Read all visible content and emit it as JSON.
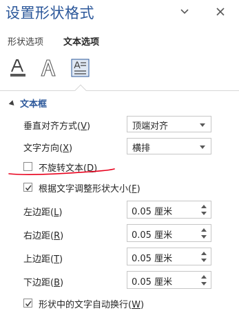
{
  "pane": {
    "title": "设置形状格式"
  },
  "tabs": {
    "shape_options": "形状选项",
    "text_options": "文本选项"
  },
  "section": {
    "title": "文本框"
  },
  "fields": {
    "vertical_align": {
      "label": "垂直对齐方式",
      "key": "V",
      "value": "顶端对齐"
    },
    "text_direction": {
      "label": "文字方向",
      "key": "X",
      "value": "横排"
    },
    "no_rotate": {
      "label": "不旋转文本",
      "key": "D",
      "checked": false
    },
    "autofit": {
      "label": "根据文字调整形状大小",
      "key": "F",
      "checked": true
    },
    "left_margin": {
      "label": "左边距",
      "key": "L",
      "value": "0.05 厘米"
    },
    "right_margin": {
      "label": "右边距",
      "key": "R",
      "value": "0.05 厘米"
    },
    "top_margin": {
      "label": "上边距",
      "key": "T",
      "value": "0.05 厘米"
    },
    "bottom_margin": {
      "label": "下边距",
      "key": "B",
      "value": "0.05 厘米"
    },
    "wrap_text": {
      "label": "形状中的文字自动换行",
      "key": "W",
      "checked": true
    }
  },
  "icons": {
    "pane_options": "chevron-down-icon",
    "close": "close-icon",
    "text_fill": "text-fill-outline-icon",
    "text_effects": "text-effects-icon",
    "textbox": "textbox-icon"
  },
  "colors": {
    "accent": "#2b579a",
    "annotation": "#e8001c"
  }
}
